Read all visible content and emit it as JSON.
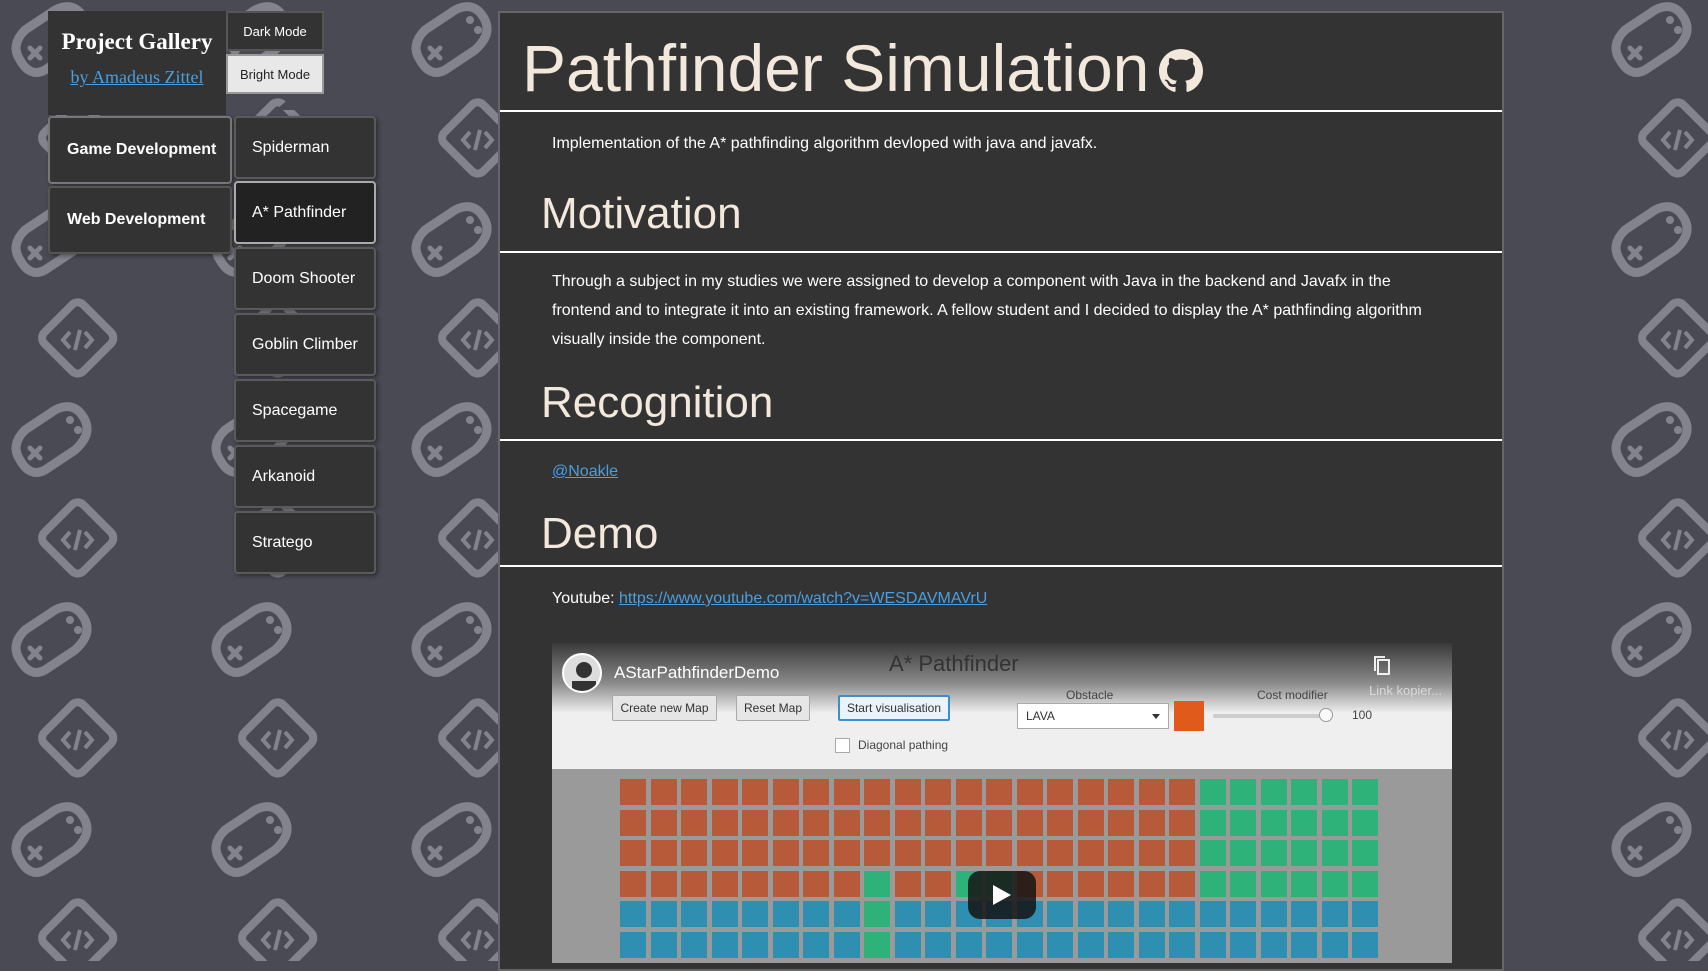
{
  "brand": {
    "title": "Project Gallery",
    "author": "by Amadeus Zittel"
  },
  "theme": {
    "dark_label": "Dark Mode",
    "bright_label": "Bright Mode"
  },
  "categories": [
    {
      "label": "Game Development",
      "active": true
    },
    {
      "label": "Web Development",
      "active": false
    }
  ],
  "projects": [
    {
      "label": "Spiderman",
      "active": false
    },
    {
      "label": "A* Pathfinder",
      "active": true
    },
    {
      "label": "Doom Shooter",
      "active": false
    },
    {
      "label": "Goblin Climber",
      "active": false
    },
    {
      "label": "Spacegame",
      "active": false
    },
    {
      "label": "Arkanoid",
      "active": false
    },
    {
      "label": "Stratego",
      "active": false
    }
  ],
  "article": {
    "title": "Pathfinder Simulation",
    "intro": "Implementation of the A* pathfinding algorithm devloped with java and javafx.",
    "motivation_heading": "Motivation",
    "motivation_text": "Through a subject in my studies we were assigned to develop a component with Java in the backend and Javafx in the frontend and to integrate it into an existing framework. A fellow student and I decided to display the A* pathfinding algorithm visually inside the component.",
    "recognition_heading": "Recognition",
    "recognition_link": "@Noakle",
    "demo_heading": "Demo",
    "youtube_label": "Youtube: ",
    "youtube_url": "https://www.youtube.com/watch?v=WESDAVMAVrU"
  },
  "video": {
    "channel": "AStarPathfinderDemo",
    "app_title": "A* Pathfinder",
    "copy_label": "Link kopier...",
    "buttons": [
      "Create new Map",
      "Reset Map",
      "Start visualisation"
    ],
    "obstacle_label": "Obstacle",
    "obstacle_value": "LAVA",
    "cost_label": "Cost modifier",
    "cost_value": "100",
    "diagonal_label": "Diagonal pathing",
    "colors": {
      "lava": "#b65a3a",
      "grass": "#2fb27a",
      "water": "#2f8fb0",
      "swatch": "#e05a1c"
    }
  },
  "colors": {
    "background": "#4a4a55",
    "panel": "#333333",
    "heading": "#f3e8dc",
    "link": "#4a9fe0"
  }
}
